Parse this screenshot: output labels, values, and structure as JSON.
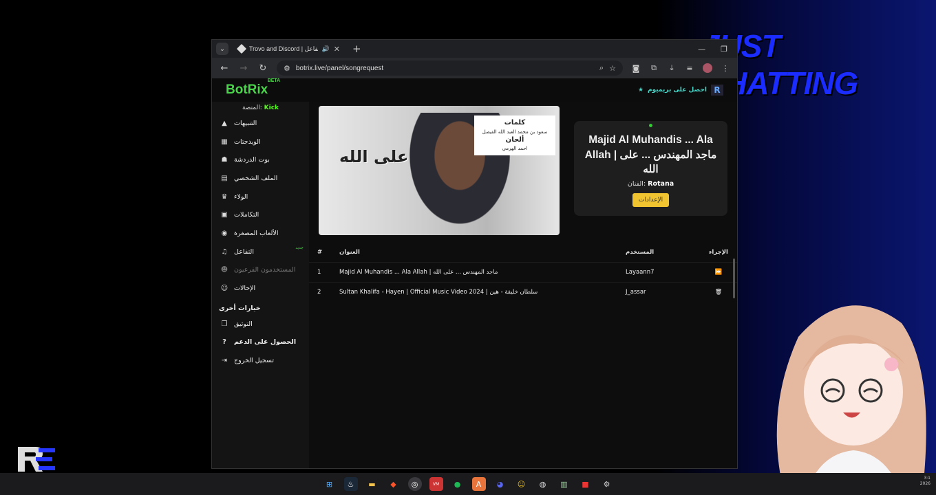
{
  "overlay": {
    "stream_title": "JUST CHATTING"
  },
  "browser": {
    "tab_title": "Trovo and Discord | التفاعل",
    "url": "botrix.live/panel/songrequest"
  },
  "page": {
    "brand": "BotRix",
    "brand_badge": "BETA",
    "premium_label": "احصل على بريميوم",
    "platform_label": "المنصة:",
    "platform_value": "Kick",
    "nav": [
      {
        "label": "التنبيهات",
        "icon": "warning-icon"
      },
      {
        "label": "الويدجتات",
        "icon": "widgets-icon"
      },
      {
        "label": "بوت الدردشة",
        "icon": "robot-icon"
      },
      {
        "label": "الملف الشخصي",
        "icon": "id-card-icon"
      },
      {
        "label": "الولاء",
        "icon": "trophy-icon"
      },
      {
        "label": "التكاملات",
        "icon": "chat-icon"
      },
      {
        "label": "الألعاب المصغرة",
        "icon": "gamepad-icon"
      },
      {
        "label": "التفاعل",
        "icon": "music-icon",
        "badge": "جديد"
      },
      {
        "label": "المستخدمون الفرعيون",
        "icon": "users-icon",
        "disabled": true
      },
      {
        "label": "الإحالات",
        "icon": "user-group-icon"
      }
    ],
    "other_options_title": "خيارات أخرى",
    "other_nav": [
      {
        "label": "التوثيق",
        "icon": "docs-icon"
      },
      {
        "label": "الحصول على الدعم",
        "icon": "help-icon"
      },
      {
        "label": "تسجيل الخروج",
        "icon": "logout-icon"
      }
    ],
    "now_playing": {
      "title": "Majid Al Muhandis ... Ala Allah | ماجد المهندس ... على الله",
      "artist_label": "الفنان:",
      "artist": "Rotana",
      "settings_button": "الإعدادات"
    },
    "cover": {
      "card_line1": "كلمات",
      "card_line2": "سعود بن محمد العبد الله الفيصل",
      "card_line3": "ألحان",
      "card_line4": "احمد الهرمي",
      "art_text": "على الله"
    },
    "queue": {
      "headers": {
        "num": "#",
        "title": "العنوان",
        "user": "المستخدم",
        "action": "الإجراء"
      },
      "rows": [
        {
          "num": "1",
          "title": "Majid Al Muhandis ... Ala Allah | ماجد المهندس ... على الله",
          "user": "Layaann7",
          "action": "skip-icon"
        },
        {
          "num": "2",
          "title": "Sultan Khalifa - Hayen | Official Music Video 2024 | سلطان خليفة - هين",
          "user": "J_assar",
          "action": "trash-icon"
        }
      ]
    }
  },
  "taskbar": {
    "time": "3:1",
    "date": "2026"
  },
  "colors": {
    "accent_green": "#4ad64a",
    "kick_green": "#53fc18",
    "button_yellow": "#f0c430",
    "overlay_blue": "#1a2cff"
  }
}
